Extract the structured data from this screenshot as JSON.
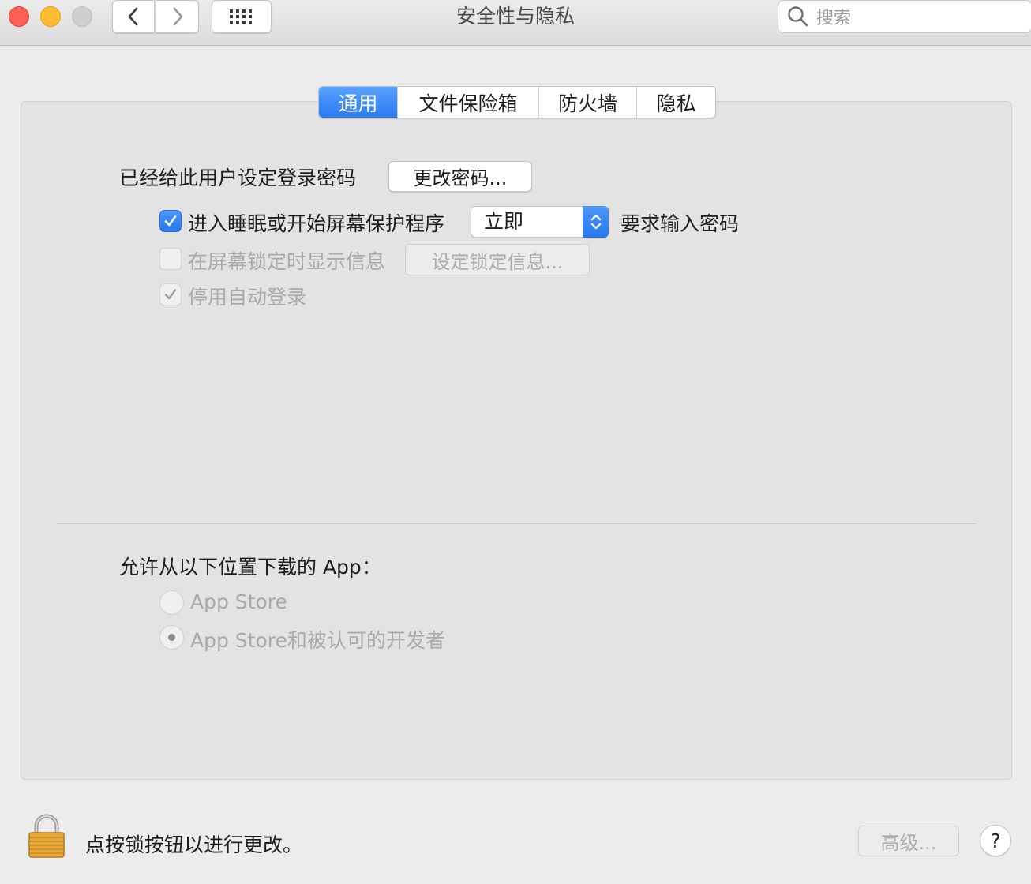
{
  "window": {
    "title": "安全性与隐私"
  },
  "toolbar": {
    "back_icon": "chevron-left-icon",
    "forward_icon": "chevron-right-icon",
    "grid_icon": "show-all-grid-icon",
    "search_placeholder": "搜索"
  },
  "tabs": [
    {
      "label": "通用",
      "active": true
    },
    {
      "label": "文件保险箱",
      "active": false
    },
    {
      "label": "防火墙",
      "active": false
    },
    {
      "label": "隐私",
      "active": false
    }
  ],
  "general": {
    "password_label": "已经给此用户设定登录密码",
    "change_password_button": "更改密码...",
    "require_password": {
      "checked": true,
      "label": "进入睡眠或开始屏幕保护程序",
      "delay_value": "立即",
      "suffix": "要求输入密码"
    },
    "show_message": {
      "checked": false,
      "enabled": false,
      "label": "在屏幕锁定时显示信息",
      "button": "设定锁定信息..."
    },
    "disable_auto_login": {
      "checked": true,
      "enabled": false,
      "label": "停用自动登录"
    },
    "download_label": "允许从以下位置下载的 App：",
    "download_options": [
      {
        "label": "App Store",
        "selected": false
      },
      {
        "label": "App Store和被认可的开发者",
        "selected": true
      }
    ]
  },
  "footer": {
    "lock_text": "点按锁按钮以进行更改。",
    "advanced_button": "高级...",
    "help_button": "?"
  },
  "colors": {
    "accent": "#2a7cf2",
    "close": "#fe5f57",
    "minimize": "#febc2e",
    "zoom_disabled": "#cfcfcf",
    "lock_gold": "#e8a93a"
  }
}
